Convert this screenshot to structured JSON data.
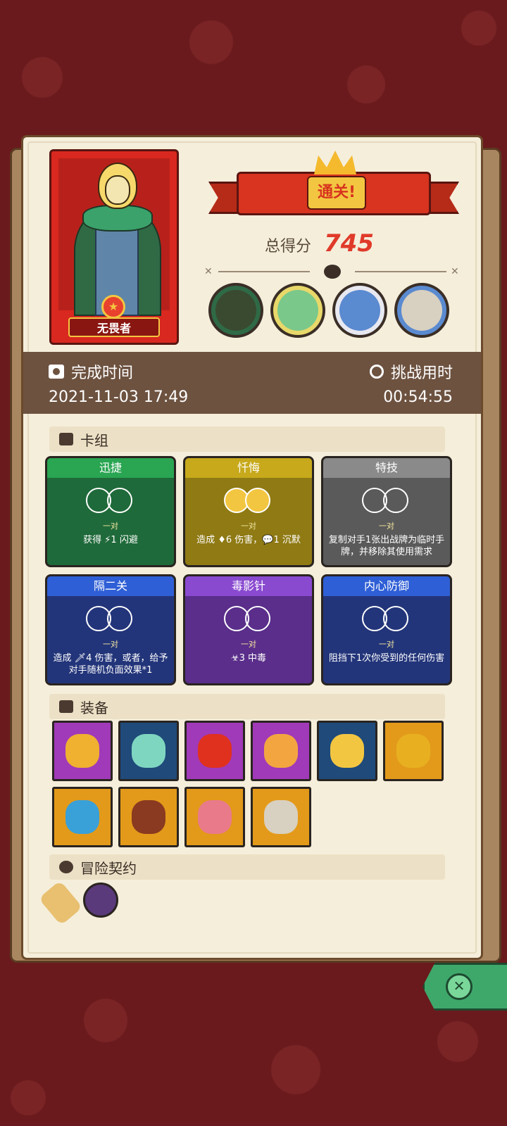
{
  "hero": {
    "name": "无畏者"
  },
  "result": {
    "banner": "通关!",
    "score_label": "总得分",
    "score_value": "745"
  },
  "time": {
    "complete_label": "完成时间",
    "complete_value": "2021-11-03 17:49",
    "challenge_label": "挑战用时",
    "challenge_value": "00:54:55"
  },
  "deck": {
    "title": "卡组",
    "cards": [
      {
        "name": "迅捷",
        "pair": "一对",
        "desc": "获得 ⚡1 闪避",
        "color": "#1f6a3a",
        "head": "#2aa552",
        "gold": false
      },
      {
        "name": "忏悔",
        "pair": "一对",
        "desc": "造成 ♦6 伤害，💬1 沉默",
        "color": "#8f7a14",
        "head": "#c7a91b",
        "gold": true
      },
      {
        "name": "特技",
        "pair": "一对",
        "desc": "复制对手1张出战牌为临时手牌，并移除其使用需求",
        "color": "#5a5a5a",
        "head": "#8a8a8a",
        "gold": false
      },
      {
        "name": "隔二关",
        "pair": "一对",
        "desc": "造成 🗡4 伤害，或者，给予对手随机负面效果*1",
        "color": "#23357a",
        "head": "#2f5fd6",
        "gold": false
      },
      {
        "name": "毒影针",
        "pair": "一对",
        "desc": "☣3 中毒",
        "color": "#5a2e8a",
        "head": "#8a4ad0",
        "gold": false
      },
      {
        "name": "内心防御",
        "pair": "一对",
        "desc": "阻挡下1次你受到的任何伤害",
        "color": "#23357a",
        "head": "#2f5fd6",
        "gold": false
      }
    ]
  },
  "equipment": {
    "title": "装备",
    "items": [
      {
        "icon": "fire-potion-icon",
        "bg": "pp",
        "color": "#f0b030"
      },
      {
        "icon": "magic-ring-icon",
        "bg": "nv",
        "color": "#7fd6c0"
      },
      {
        "icon": "flame-sword-icon",
        "bg": "pp",
        "color": "#e0301e"
      },
      {
        "icon": "crown-icon",
        "bg": "pp",
        "color": "#f3a640"
      },
      {
        "icon": "gold-helmet-icon",
        "bg": "nv",
        "color": "#f3c641"
      },
      {
        "icon": "gold-coin-icon",
        "bg": "og",
        "color": "#e8b020"
      },
      {
        "icon": "spirit-flame-icon",
        "bg": "og",
        "color": "#3aa0d8"
      },
      {
        "icon": "hood-icon",
        "bg": "og",
        "color": "#8a3a20"
      },
      {
        "icon": "potion-jar-icon",
        "bg": "og",
        "color": "#e87a8a"
      },
      {
        "icon": "horn-icon",
        "bg": "og",
        "color": "#d8d0c0"
      }
    ]
  },
  "contracts": {
    "title": "冒险契约",
    "items": [
      {
        "icon": "scroll-icon",
        "color": "#e8c070"
      },
      {
        "icon": "dark-orb-icon",
        "color": "#5a3a7a"
      }
    ]
  },
  "bosses": [
    {
      "icon": "knight-boss-icon",
      "color": "#3a4a30"
    },
    {
      "icon": "dragon-boss-icon",
      "color": "#7ac88a"
    },
    {
      "icon": "yeti-boss-icon",
      "color": "#5a8ad0"
    },
    {
      "icon": "skeleton-boss-icon",
      "color": "#d8d0c0"
    }
  ]
}
